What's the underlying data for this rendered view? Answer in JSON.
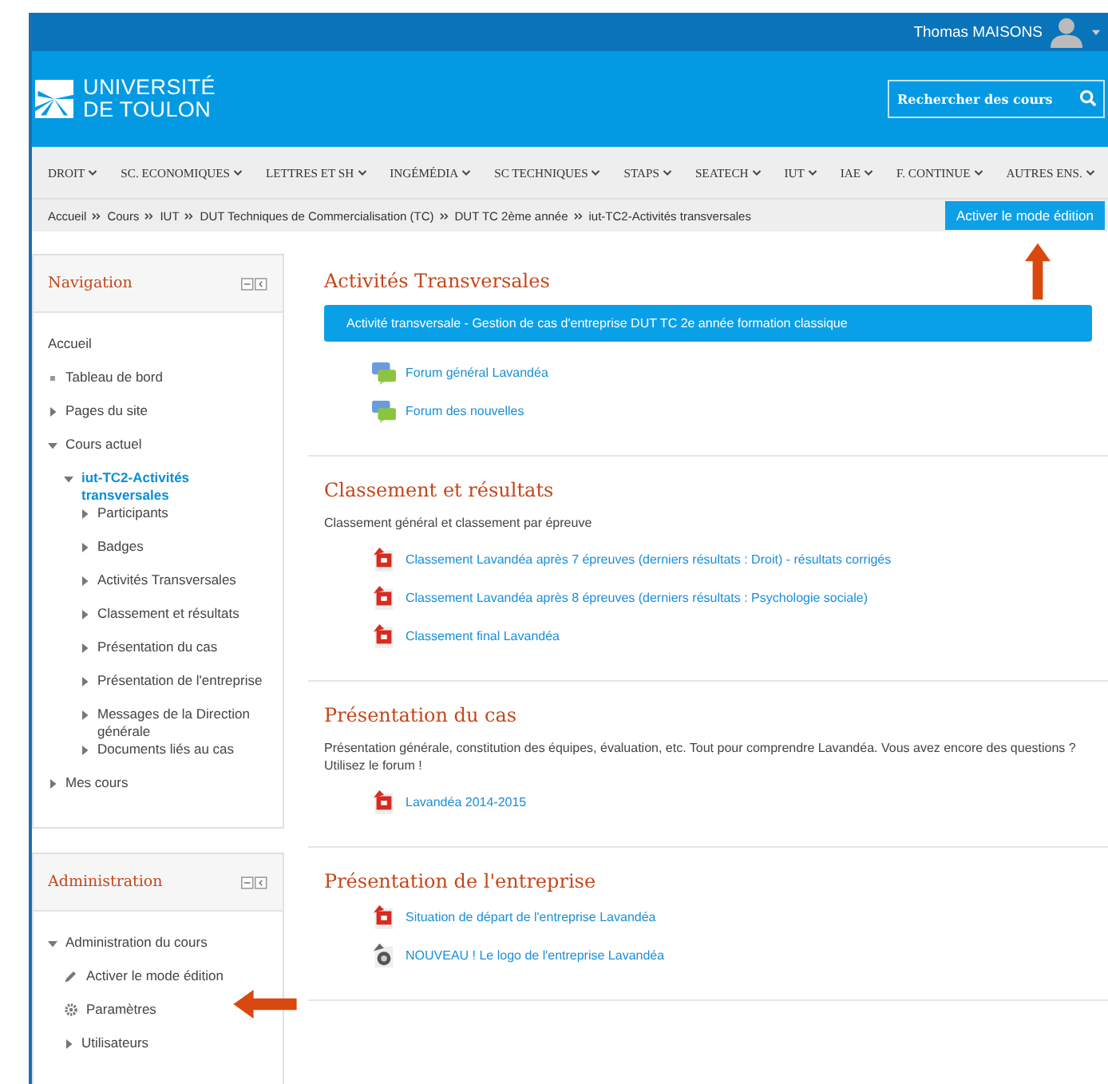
{
  "user_menu": {
    "name": "Thomas MAISONS"
  },
  "logo": {
    "line_1": "UNIVERSITÉ",
    "line_2": "DE TOULON"
  },
  "search": {
    "placeholder": "Rechercher des cours"
  },
  "menu": [
    "DROIT",
    "SC. ECONOMIQUES",
    "LETTRES ET SH",
    "INGÉMÉDIA",
    "SC TECHNIQUES",
    "STAPS",
    "SEATECH",
    "IUT",
    "IAE",
    "F. CONTINUE",
    "AUTRES ENS."
  ],
  "breadcrumb": [
    "Accueil",
    "Cours",
    "IUT",
    "DUT Techniques de Commercialisation (TC)",
    "DUT TC 2ème année",
    "iut-TC2-Activités transversales"
  ],
  "edit_button": "Activer le mode édition",
  "navigation": {
    "title": "Navigation",
    "items": [
      {
        "label": "Accueil",
        "kind": "plain"
      },
      {
        "label": "Tableau de bord",
        "kind": "bullet"
      },
      {
        "label": "Pages du site",
        "kind": "branch",
        "expanded": false
      },
      {
        "label": "Cours actuel",
        "kind": "branch",
        "expanded": true,
        "children": [
          {
            "label": "iut-TC2-Activités transversales",
            "kind": "branch",
            "expanded": true,
            "selected": true,
            "children": [
              {
                "label": "Participants",
                "kind": "branch",
                "expanded": false,
                "selected": false
              },
              {
                "label": "Badges",
                "kind": "branch",
                "expanded": false,
                "selected": false
              },
              {
                "label": "Activités Transversales",
                "kind": "branch",
                "expanded": false,
                "selected": false
              },
              {
                "label": "Classement et résultats",
                "kind": "branch",
                "expanded": false,
                "selected": false
              },
              {
                "label": "Présentation du cas",
                "kind": "branch",
                "expanded": false,
                "selected": false
              },
              {
                "label": "Présentation de l'entreprise",
                "kind": "branch",
                "expanded": false,
                "selected": false
              },
              {
                "label": "Messages de la Direction générale",
                "kind": "branch",
                "expanded": false,
                "selected": false
              },
              {
                "label": "Documents liés au cas",
                "kind": "branch",
                "expanded": false,
                "selected": false
              }
            ]
          }
        ]
      },
      {
        "label": "Mes cours",
        "kind": "branch",
        "expanded": false
      }
    ]
  },
  "administration": {
    "title": "Administration",
    "items": [
      {
        "label": "Administration du cours",
        "kind": "branch",
        "expanded": true,
        "children": [
          {
            "label": "Activer le mode édition",
            "kind": "pencil"
          },
          {
            "label": "Paramètres",
            "kind": "gear"
          },
          {
            "label": "Utilisateurs",
            "kind": "branch",
            "expanded": false
          }
        ]
      }
    ]
  },
  "sections": [
    {
      "title": "Activités Transversales",
      "banner": "Activité transversale - Gestion de cas d'entreprise DUT TC 2e année formation classique",
      "activities": [
        {
          "kind": "forum",
          "label": "Forum général Lavandéa"
        },
        {
          "kind": "forum",
          "label": "Forum des nouvelles"
        }
      ]
    },
    {
      "title": "Classement et résultats",
      "description": "Classement général et classement par épreuve",
      "activities": [
        {
          "kind": "pdf",
          "label": "Classement Lavandéa après 7 épreuves (derniers résultats : Droit) - résultats corrigés"
        },
        {
          "kind": "pdf",
          "label": "Classement Lavandéa après 8 épreuves (derniers résultats : Psychologie sociale)"
        },
        {
          "kind": "pdf",
          "label": "Classement final Lavandéa"
        }
      ]
    },
    {
      "title": "Présentation du cas",
      "description": "Présentation générale, constitution des équipes, évaluation, etc. Tout pour comprendre Lavandéa. Vous avez encore des questions ? Utilisez le forum !",
      "activities": [
        {
          "kind": "pdf",
          "label": "Lavandéa 2014-2015"
        }
      ]
    },
    {
      "title": "Présentation de l'entreprise",
      "activities": [
        {
          "kind": "pdf",
          "label": "Situation de départ de l'entreprise Lavandéa"
        },
        {
          "kind": "image",
          "label": "NOUVEAU ! Le logo de l'entreprise Lavandéa"
        }
      ]
    }
  ]
}
